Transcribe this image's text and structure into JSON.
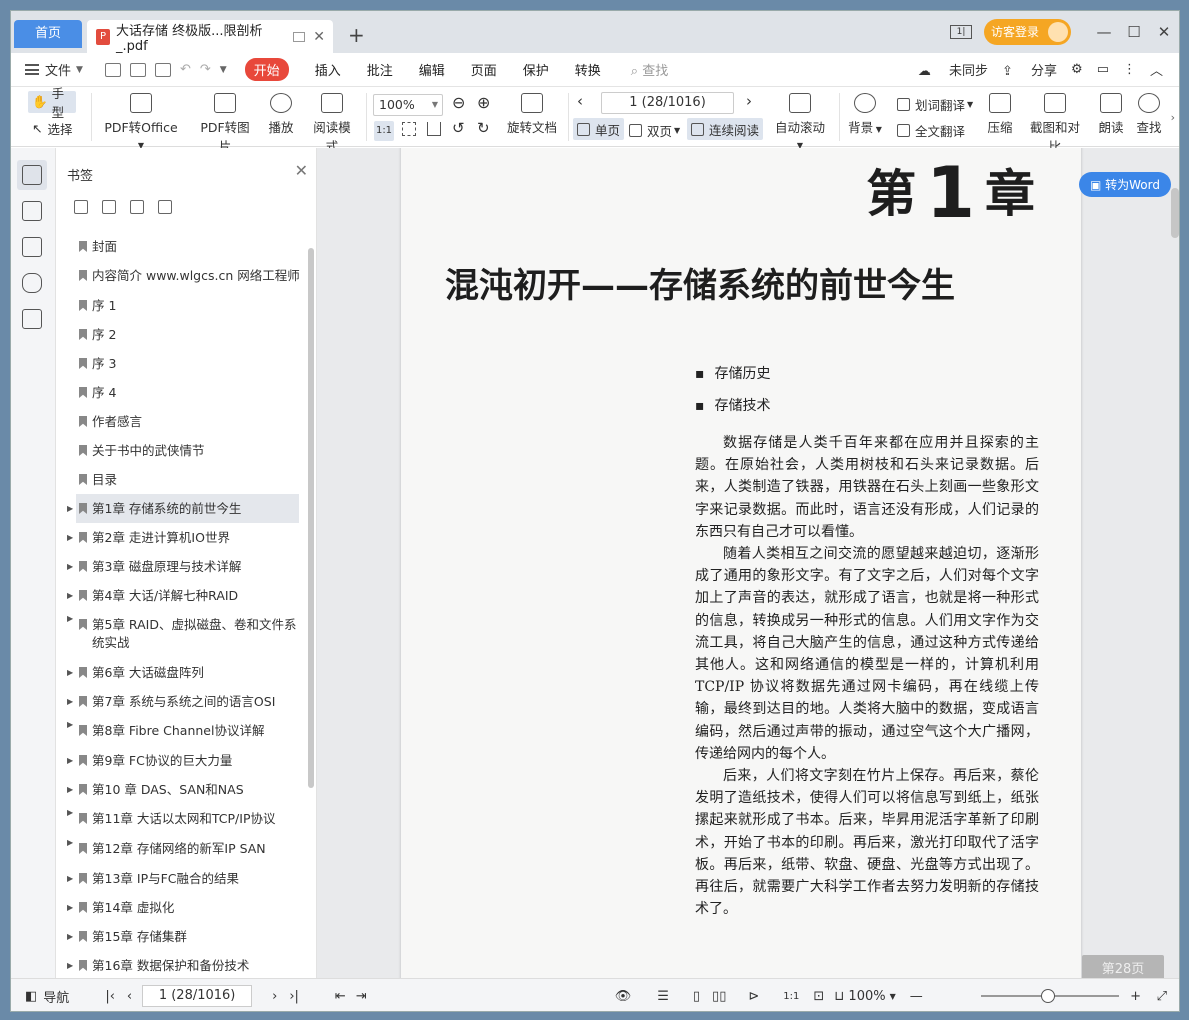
{
  "titlebar": {
    "home_tab": "首页",
    "doc_tab": "大话存储 终极版...限剖析_.pdf",
    "add_tab": "+",
    "guest_login": "访客登录",
    "dual_page_icon": "1|"
  },
  "menubar": {
    "file": "文件",
    "items": [
      "开始",
      "插入",
      "批注",
      "编辑",
      "页面",
      "保护",
      "转换"
    ],
    "active": "开始",
    "search": "查找",
    "not_synced": "未同步",
    "share": "分享"
  },
  "ribbon": {
    "hand": "手型",
    "select": "选择",
    "pdf_to_office": "PDF转Office",
    "pdf_to_image": "PDF转图片",
    "play": "播放",
    "read_mode": "阅读模式",
    "zoom": "100%",
    "rotate_doc": "旋转文档",
    "page_field": "1 (28/1016)",
    "single_page": "单页",
    "double_page": "双页",
    "continuous": "连续阅读",
    "auto_scroll": "自动滚动",
    "background": "背景",
    "word_translate": "划词翻译",
    "full_translate": "全文翻译",
    "compress": "压缩",
    "screenshot_compare": "截图和对比",
    "read_aloud": "朗读",
    "find": "查找"
  },
  "bookmarks": {
    "title": "书签",
    "items": [
      {
        "label": "封面",
        "expandable": false
      },
      {
        "label": "内容简介 www.wlgcs.cn 网络工程师",
        "expandable": false
      },
      {
        "label": "序  1",
        "expandable": false
      },
      {
        "label": "序 2",
        "expandable": false
      },
      {
        "label": "序 3",
        "expandable": false
      },
      {
        "label": "序 4",
        "expandable": false
      },
      {
        "label": "作者感言",
        "expandable": false
      },
      {
        "label": "关于书中的武侠情节",
        "expandable": false
      },
      {
        "label": "目录",
        "expandable": false
      },
      {
        "label": "第1章  存储系统的前世今生",
        "expandable": true,
        "selected": true
      },
      {
        "label": "第2章  走进计算机IO世界",
        "expandable": true
      },
      {
        "label": "第3章  磁盘原理与技术详解",
        "expandable": true
      },
      {
        "label": "第4章  大话/详解七种RAID",
        "expandable": true
      },
      {
        "label": "第5章 RAID、虚拟磁盘、卷和文件系统实战",
        "expandable": true
      },
      {
        "label": "第6章 大话磁盘阵列",
        "expandable": true
      },
      {
        "label": "第7章 系统与系统之间的语言OSI",
        "expandable": true
      },
      {
        "label": "第8章 Fibre Channel协议详解",
        "expandable": true
      },
      {
        "label": "第9章 FC协议的巨大力量",
        "expandable": true
      },
      {
        "label": "第10 章 DAS、SAN和NAS",
        "expandable": true
      },
      {
        "label": "第11章 大话以太网和TCP/IP协议",
        "expandable": true
      },
      {
        "label": "第12章 存储网络的新军IP SAN",
        "expandable": true
      },
      {
        "label": "第13章 IP与FC融合的结果",
        "expandable": true
      },
      {
        "label": "第14章 虚拟化",
        "expandable": true
      },
      {
        "label": "第15章 存储集群",
        "expandable": true
      },
      {
        "label": "第16章 数据保护和备份技术",
        "expandable": true
      }
    ]
  },
  "document": {
    "chapter_prefix": "第",
    "chapter_number": "1",
    "chapter_suffix": "章",
    "heading": "混沌初开——存储系统的前世今生",
    "bullets": [
      "存储历史",
      "存储技术"
    ],
    "paragraphs": [
      "数据存储是人类千百年来都在应用并且探索的主题。在原始社会，人类用树枝和石头来记录数据。后来，人类制造了铁器，用铁器在石头上刻画一些象形文字来记录数据。而此时，语言还没有形成，人们记录的东西只有自己才可以看懂。",
      "随着人类相互之间交流的愿望越来越迫切，逐渐形成了通用的象形文字。有了文字之后，人们对每个文字加上了声音的表达，就形成了语言，也就是将一种形式的信息，转换成另一种形式的信息。人们用文字作为交流工具，将自己大脑产生的信息，通过这种方式传递给其他人。这和网络通信的模型是一样的，计算机利用TCP/IP 协议将数据先通过网卡编码，再在线缆上传输，最终到达目的地。人类将大脑中的数据，变成语言编码，然后通过声带的振动，通过空气这个大广播网，传递给网内的每个人。",
      "后来，人们将文字刻在竹片上保存。再后来，蔡伦发明了造纸技术，使得人们可以将信息写到纸上，纸张摞起来就形成了书本。后来，毕昇用泥活字革新了印刷术，开始了书本的印刷。再后来，激光打印取代了活字板。再后来，纸带、软盘、硬盘、光盘等方式出现了。再往后，就需要广大科学工作者去努力发明新的存储技术了。"
    ],
    "to_word": "转为Word",
    "page_badge": "第28页"
  },
  "statusbar": {
    "nav_label": "导航",
    "page_field": "1 (28/1016)",
    "zoom": "100%"
  }
}
